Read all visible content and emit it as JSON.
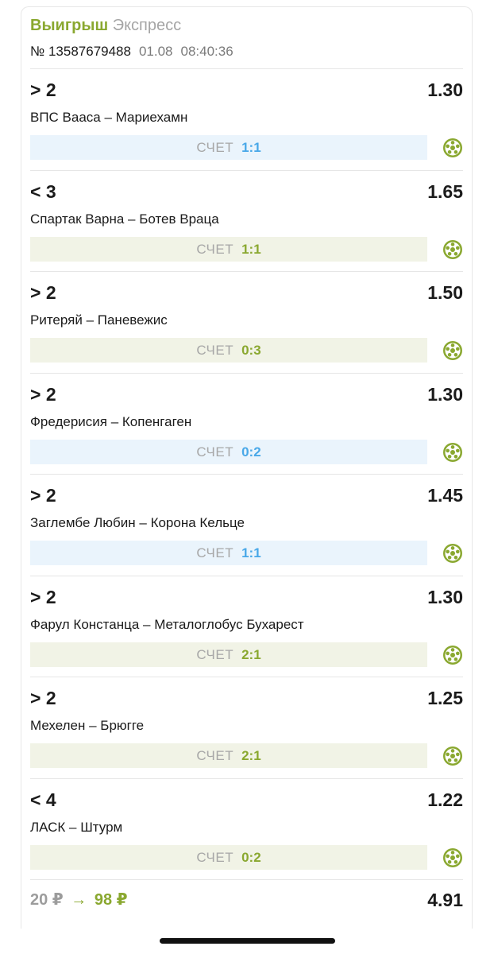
{
  "ticket": {
    "status": "Выигрыш",
    "type": "Экспресс",
    "number": "№ 13587679488",
    "date": "01.08",
    "time": "08:40:36"
  },
  "score_label": "СЧЕТ",
  "colors": {
    "win_green": "#8aa830",
    "live_blue": "#49a8e8",
    "live_bg": "#eaf4fc",
    "done_bg": "#f1f3e6",
    "ball_icon": "#8aa830"
  },
  "events": [
    {
      "outcome": "> 2",
      "odds": "1.30",
      "match": "ВПС Вааса – Мариехамн",
      "score": "1:1",
      "state": "live",
      "icon": "football-ball-icon"
    },
    {
      "outcome": "< 3",
      "odds": "1.65",
      "match": "Спартак Варна – Ботев Враца",
      "score": "1:1",
      "state": "done",
      "icon": "football-ball-icon"
    },
    {
      "outcome": "> 2",
      "odds": "1.50",
      "match": "Ритеряй – Паневежис",
      "score": "0:3",
      "state": "done",
      "icon": "football-ball-icon"
    },
    {
      "outcome": "> 2",
      "odds": "1.30",
      "match": "Фредерисия – Копенгаген",
      "score": "0:2",
      "state": "live",
      "icon": "football-ball-icon"
    },
    {
      "outcome": "> 2",
      "odds": "1.45",
      "match": "Заглембе Любин – Корона Кельце",
      "score": "1:1",
      "state": "live",
      "icon": "football-ball-icon"
    },
    {
      "outcome": "> 2",
      "odds": "1.30",
      "match": "Фарул Констанца – Металоглобус Бухарест",
      "score": "2:1",
      "state": "done",
      "icon": "football-ball-icon"
    },
    {
      "outcome": "> 2",
      "odds": "1.25",
      "match": "Мехелен – Брюгге",
      "score": "2:1",
      "state": "done",
      "icon": "football-ball-icon"
    },
    {
      "outcome": "< 4",
      "odds": "1.22",
      "match": "ЛАСК – Штурм",
      "score": "0:2",
      "state": "done",
      "icon": "football-ball-icon"
    }
  ],
  "footer": {
    "stake": "20 ₽",
    "arrow": "→",
    "payout": "98 ₽",
    "total_odds": "4.91"
  }
}
